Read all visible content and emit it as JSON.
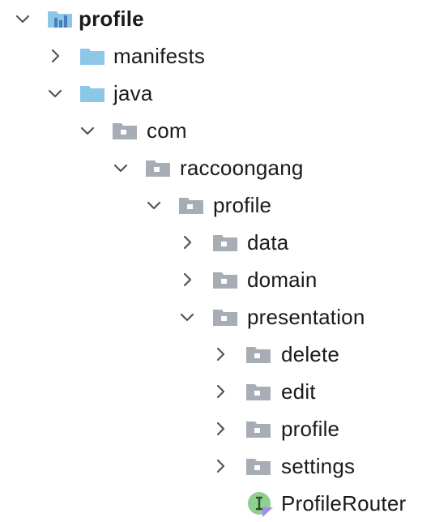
{
  "tree": {
    "root": {
      "label": "profile",
      "icon": "module-icon",
      "expanded": true
    },
    "manifests": {
      "label": "manifests",
      "icon": "folder-icon",
      "expanded": false
    },
    "java": {
      "label": "java",
      "icon": "folder-icon",
      "expanded": true
    },
    "com": {
      "label": "com",
      "icon": "package-icon",
      "expanded": true
    },
    "raccoongang": {
      "label": "raccoongang",
      "icon": "package-icon",
      "expanded": true
    },
    "profile_pkg": {
      "label": "profile",
      "icon": "package-icon",
      "expanded": true
    },
    "data": {
      "label": "data",
      "icon": "package-icon",
      "expanded": false
    },
    "domain": {
      "label": "domain",
      "icon": "package-icon",
      "expanded": false
    },
    "presentation": {
      "label": "presentation",
      "icon": "package-icon",
      "expanded": true
    },
    "delete": {
      "label": "delete",
      "icon": "package-icon",
      "expanded": false
    },
    "edit": {
      "label": "edit",
      "icon": "package-icon",
      "expanded": false
    },
    "profile_sub": {
      "label": "profile",
      "icon": "package-icon",
      "expanded": false
    },
    "settings": {
      "label": "settings",
      "icon": "package-icon",
      "expanded": false
    },
    "profile_router": {
      "label": "ProfileRouter",
      "icon": "kotlin-interface-icon"
    }
  },
  "colors": {
    "module_blue": "#6a9bd1",
    "folder_blue": "#8cc7e8",
    "package_gray": "#a6adb5",
    "interface_green": "#8fcf8f",
    "kotlin_purple": "#a48cf0",
    "chevron": "#555555"
  }
}
